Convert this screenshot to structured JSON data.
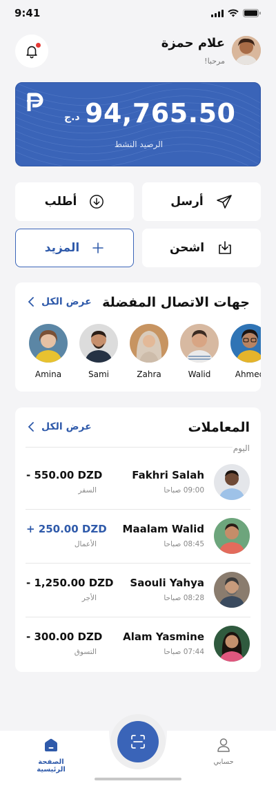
{
  "status": {
    "time": "9:41"
  },
  "header": {
    "user_name": "علام حمزة",
    "greeting": "مرحبا!"
  },
  "balance": {
    "currency": "د.ج",
    "amount": "94,765.50",
    "label": "الرصيد النشط"
  },
  "actions": {
    "send": "أرسل",
    "request": "أطلب",
    "topup": "اشحن",
    "more": "المزيد"
  },
  "contacts_section": {
    "title": "جهات الاتصال المفضلة",
    "view_all": "عرض الكل",
    "contacts": [
      {
        "name": "Amina"
      },
      {
        "name": "Sami"
      },
      {
        "name": "Zahra"
      },
      {
        "name": "Walid"
      },
      {
        "name": "Ahmed"
      }
    ]
  },
  "transactions_section": {
    "title": "المعاملات",
    "view_all": "عرض الكل",
    "day_label": "اليوم",
    "items": [
      {
        "name": "Fakhri Salah",
        "time": "09:00 صباحا",
        "amount": "- 550.00 DZD",
        "category": "السفر"
      },
      {
        "name": "Maalam Walid",
        "time": "08:45 صباحا",
        "amount": "+ 250.00 DZD",
        "category": "الأعمال"
      },
      {
        "name": "Saouli Yahya",
        "time": "08:28 صباحا",
        "amount": "- 1,250.00 DZD",
        "category": "الأجر"
      },
      {
        "name": "Alam Yasmine",
        "time": "07:44 صباحا",
        "amount": "- 300.00 DZD",
        "category": "التسوق"
      }
    ]
  },
  "tabbar": {
    "home": "الصفحة الرئيسية",
    "account": "حسابي"
  },
  "colors": {
    "primary": "#3a64b8",
    "background": "#f4f4f6",
    "alert": "#e53935"
  }
}
